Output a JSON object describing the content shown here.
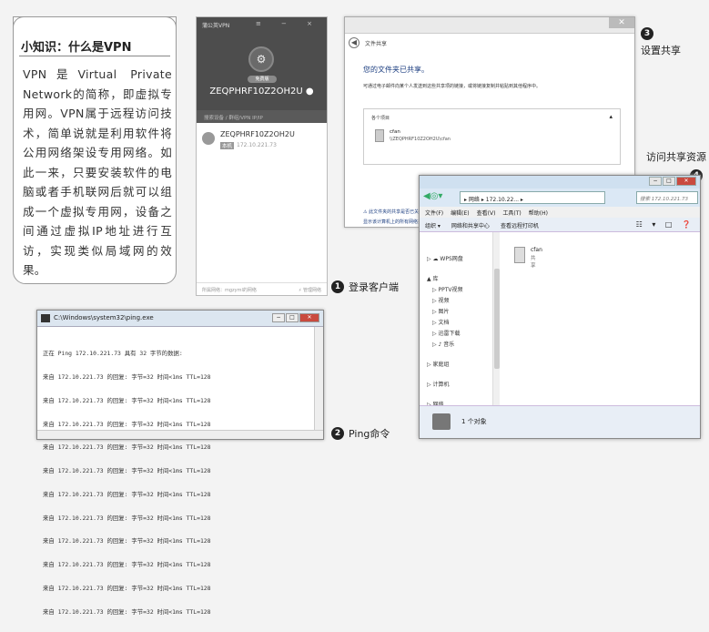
{
  "knowledge": {
    "title": "小知识：什么是VPN",
    "body": "VPN是Virtual Private Network的简称，即虚拟专用网。VPN属于远程访问技术，简单说就是利用软件将公用网络架设专用网络。如此一来，只要安装软件的电脑或者手机联网后就可以组成一个虚拟专用网，设备之间通过虚拟IP地址进行互访，实现类似局域网的效果。"
  },
  "vpn_client": {
    "app_name": "蒲公英VPN",
    "window_controls": "≡ − ×",
    "logo": "⚙",
    "badge": "免费版",
    "hostname": "ZEQPHRF10Z2OH2U ●",
    "search_placeholder": "搜索设备 / 群组/VPN IP/IP",
    "peer": {
      "name": "ZEQPHRF10Z2OH2U",
      "tag": "本机",
      "ip": "172.10.221.73"
    },
    "footer_left": "所属网络：mgzyml的网络",
    "footer_right": "⚡ 管理网络"
  },
  "steps": [
    {
      "num": "1",
      "label": "登录客户端"
    },
    {
      "num": "2",
      "label": "Ping命令"
    },
    {
      "num": "3",
      "label": "设置共享"
    },
    {
      "num": "4",
      "label": "访问共享资源"
    }
  ],
  "share_window": {
    "title": "文件共享",
    "back": "◀",
    "close": "✕",
    "heading": "您的文件夹已共享。",
    "description": "可通过电子邮件向某个人发送到这些共享项的链接，或将链接复制并粘贴到其他程序中。",
    "items_header": "各个项目",
    "fold": "▴",
    "file_name": "cfan",
    "file_path": "\\\\ZEQPHRF10Z2OH2U\\cfan",
    "link1": "⚠ 此文件夹的共享是否已关闭。",
    "link2": "显示该计算机上的所有网络共享。"
  },
  "explorer": {
    "caption_buttons": [
      "−",
      "□",
      "✕"
    ],
    "back": "◀◎▾",
    "address": "▸ 网络 ▸ 172.10.22... ▸",
    "search_placeholder": "搜索 172.10.221.73",
    "menu": [
      "文件(F)",
      "编辑(E)",
      "查看(V)",
      "工具(T)",
      "帮助(H)"
    ],
    "toolbar": [
      "组织 ▾",
      "网络和共享中心",
      "查看远程打印机"
    ],
    "view_icons": "☷ ▾ □ ❓",
    "nav": [
      "▷ ☁ WPS网盘",
      "▲ 库",
      "▷ PPTV视频",
      "▷ 视频",
      "▷ 图片",
      "▷ 文档",
      "▷ 迅雷下载",
      "▷ ♪ 音乐",
      "▷ 家庭组",
      "▷ 计算机",
      "▷ 网络"
    ],
    "folder_name": "cfan",
    "folder_sub": "共享",
    "status": "1 个对象"
  },
  "cmd": {
    "title": "C:\\Windows\\system32\\ping.exe",
    "buttons": [
      "−",
      "□",
      "✕"
    ],
    "lines": [
      "正在 Ping 172.10.221.73 具有 32 字节的数据:",
      "来自 172.10.221.73 的回复: 字节=32 时间<1ms TTL=128",
      "来自 172.10.221.73 的回复: 字节=32 时间<1ms TTL=128",
      "来自 172.10.221.73 的回复: 字节=32 时间<1ms TTL=128",
      "来自 172.10.221.73 的回复: 字节=32 时间<1ms TTL=128",
      "来自 172.10.221.73 的回复: 字节=32 时间<1ms TTL=128",
      "来自 172.10.221.73 的回复: 字节=32 时间<1ms TTL=128",
      "来自 172.10.221.73 的回复: 字节=32 时间<1ms TTL=128",
      "来自 172.10.221.73 的回复: 字节=32 时间<1ms TTL=128",
      "来自 172.10.221.73 的回复: 字节=32 时间<1ms TTL=128",
      "来自 172.10.221.73 的回复: 字节=32 时间<1ms TTL=128",
      "来自 172.10.221.73 的回复: 字节=32 时间<1ms TTL=128"
    ]
  }
}
